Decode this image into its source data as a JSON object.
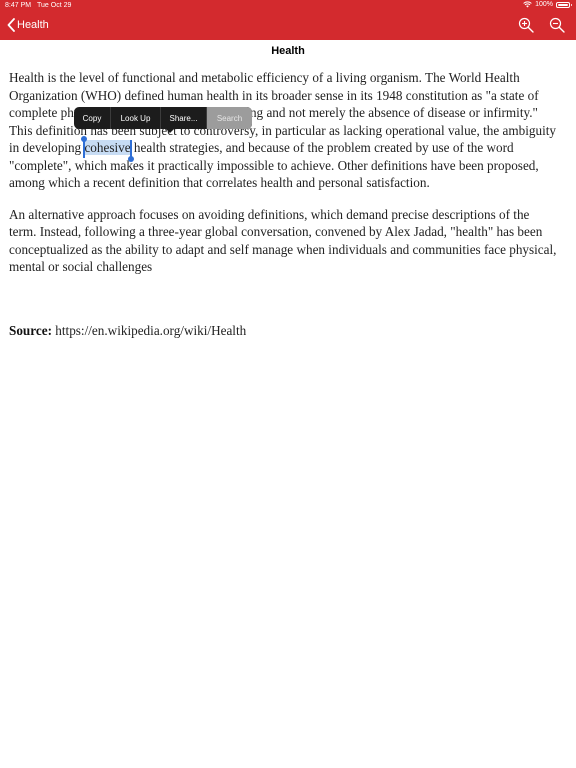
{
  "status_bar": {
    "time": "8:47 PM",
    "date": "Tue Oct 29",
    "battery": "100%"
  },
  "nav": {
    "back_label": "Health",
    "zoom_in_icon": "zoom-in-icon",
    "zoom_out_icon": "zoom-out-icon"
  },
  "page": {
    "title": "Health"
  },
  "article": {
    "p1_a": "Health is the level of functional and metabolic efficiency of a living organism. The World Health Organization (WHO) defined human health in its broader sense in its 1948 constitution as \"a state of complete physical, mental and social well-being and not merely the absence of disease or infirmity.\" This definition has been subject to controversy, in particular as lacking operational value, the ambiguity in developing ",
    "p1_selected": "cohesive",
    "p1_b": " health strategies, and because of the problem created by use of the word \"complete\", which makes it practically impossible to achieve. Other definitions have been proposed, among which a recent definition that correlates health and personal satisfaction.",
    "p2": "An alternative approach focuses on avoiding definitions, which demand precise descriptions of the term. Instead, following a three-year global conversation, convened by Alex Jadad, \"health\" has been conceptualized as the ability to adapt and self manage when individuals and communities face physical, mental or social challenges"
  },
  "source": {
    "label": "Source:",
    "url": "https://en.wikipedia.org/wiki/Health"
  },
  "context_menu": {
    "copy": "Copy",
    "look_up": "Look Up",
    "share": "Share...",
    "search": "Search"
  },
  "colors": {
    "nav_bar": "#d32a2e",
    "selection": "#c7dcf4",
    "handle": "#2f6fd6"
  }
}
